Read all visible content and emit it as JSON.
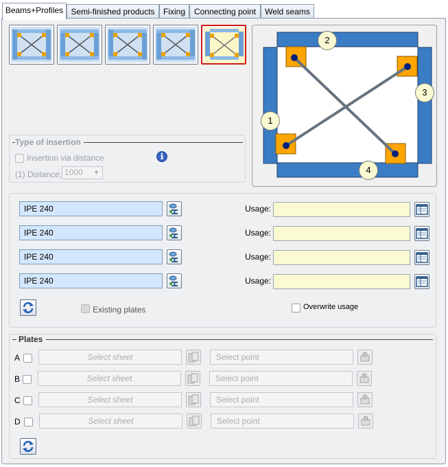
{
  "tabs": [
    {
      "label": "Beams+Profiles",
      "active": true
    },
    {
      "label": "Semi-finished products",
      "active": false
    },
    {
      "label": "Fixing",
      "active": false
    },
    {
      "label": "Connecting point",
      "active": false
    },
    {
      "label": "Weld seams",
      "active": false
    }
  ],
  "preview": {
    "badges": [
      "1",
      "2",
      "3",
      "4"
    ]
  },
  "insertion": {
    "title": "Type of insertion",
    "via_distance_label": "Insertion via distance",
    "distance_label": "(1) Distance:",
    "distance_value": "1000"
  },
  "beams": {
    "usage_label": "Usage:",
    "rows": [
      {
        "profile": "IPE 240",
        "usage": ""
      },
      {
        "profile": "IPE 240",
        "usage": ""
      },
      {
        "profile": "IPE 240",
        "usage": ""
      },
      {
        "profile": "IPE 240",
        "usage": ""
      }
    ],
    "existing_plates_label": "Existing plates",
    "overwrite_usage_label": "Overwrite usage"
  },
  "plates": {
    "title": "Plates",
    "rows": [
      {
        "letter": "A",
        "sheet_placeholder": "Select sheet",
        "point_placeholder": "Select point"
      },
      {
        "letter": "B",
        "sheet_placeholder": "Select sheet",
        "point_placeholder": "Select point"
      },
      {
        "letter": "C",
        "sheet_placeholder": "Select sheet",
        "point_placeholder": "Select point"
      },
      {
        "letter": "D",
        "sheet_placeholder": "Select sheet",
        "point_placeholder": "Select point"
      }
    ]
  },
  "colors": {
    "accent_selected": "#d21a1a",
    "beam_blue": "#3b7dc4",
    "plate_orange": "#ffa500",
    "usage_yellow": "#fafad2",
    "profile_blue": "#d3e6fb"
  }
}
